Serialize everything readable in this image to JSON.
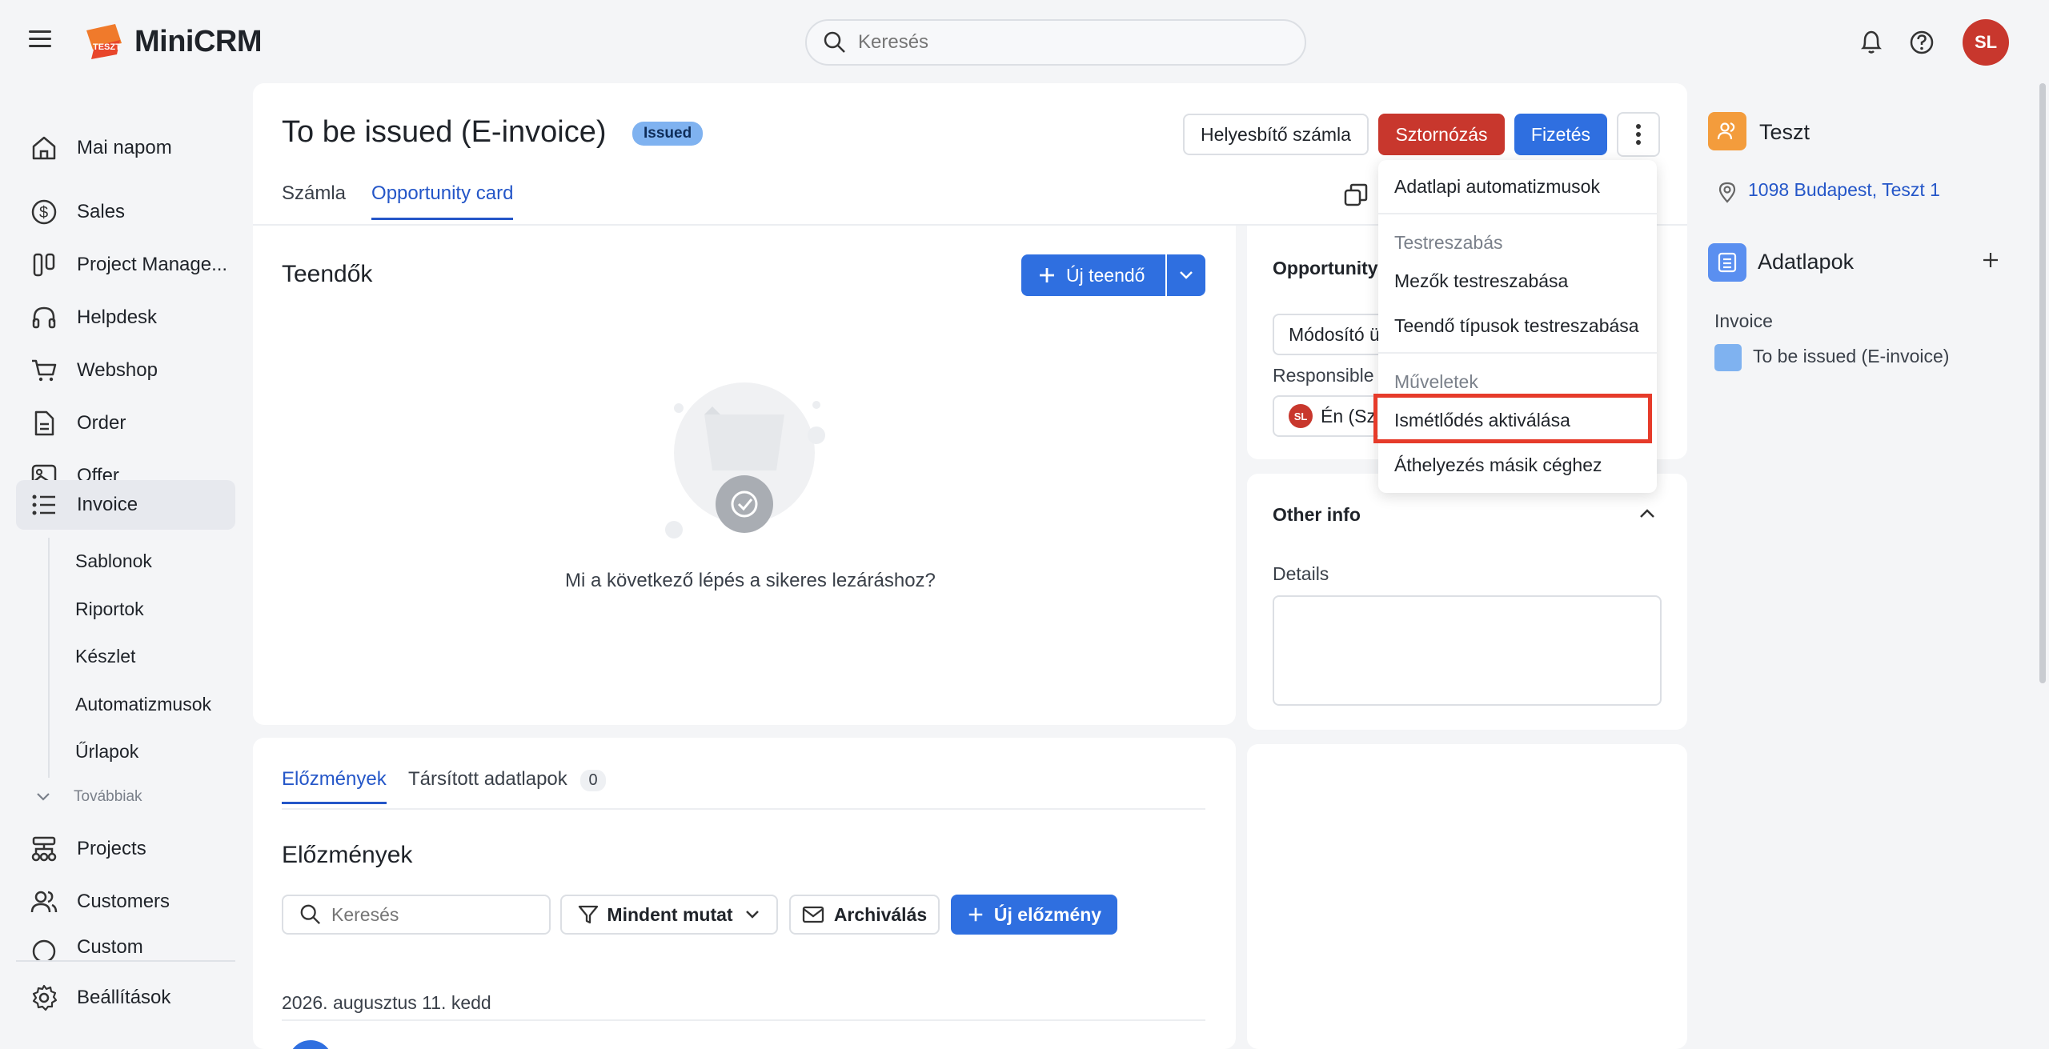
{
  "app": {
    "name": "MiniCRM",
    "logo_tag": "TESZT"
  },
  "topbar": {
    "search_placeholder": "Keresés",
    "avatar_initials": "SL"
  },
  "sidebar": {
    "items": [
      {
        "label": "Mai napom",
        "icon": "home-icon"
      },
      {
        "label": "Sales",
        "icon": "dollar-icon"
      },
      {
        "label": "Project Manage...",
        "icon": "columns-icon"
      },
      {
        "label": "Helpdesk",
        "icon": "headset-icon"
      },
      {
        "label": "Webshop",
        "icon": "cart-icon"
      },
      {
        "label": "Order",
        "icon": "document-icon"
      },
      {
        "label": "Offer",
        "icon": "image-icon"
      },
      {
        "label": "Invoice",
        "icon": "list-icon"
      }
    ],
    "sub_items": [
      "Sablonok",
      "Riportok",
      "Készlet",
      "Automatizmusok",
      "Űrlapok"
    ],
    "more_label": "Továbbiak",
    "bottom_items": [
      {
        "label": "Projects",
        "icon": "sitemap-icon"
      },
      {
        "label": "Customers",
        "icon": "users-icon"
      },
      {
        "label": "Custom",
        "icon": "circle-icon"
      }
    ],
    "settings_label": "Beállítások"
  },
  "header": {
    "title": "To be issued (E-invoice)",
    "badge": "Issued",
    "btn_corrective": "Helyesbítő számla",
    "btn_storno": "Sztornózás",
    "btn_payment": "Fizetés",
    "tabs": [
      "Számla",
      "Opportunity card"
    ]
  },
  "todos": {
    "title": "Teendők",
    "new_btn": "Új teendő",
    "empty_text": "Mi a következő lépés a sikeres lezáráshoz?"
  },
  "history": {
    "tabs": [
      "Előzmények",
      "Társított adatlapok"
    ],
    "linked_count": "0",
    "title": "Előzmények",
    "search_placeholder": "Keresés",
    "filter_label": "Mindent mutat",
    "archive_label": "Archiválás",
    "new_btn": "Új előzmény",
    "date": "2026. augusztus 11. kedd"
  },
  "opportunity": {
    "title": "Opportunity",
    "modifier_label": "Módosító ü",
    "responsible_label": "Responsible",
    "responsible_value": "Én (Sz",
    "responsible_initials": "SL"
  },
  "other_info": {
    "title": "Other info",
    "details_label": "Details"
  },
  "dropdown": {
    "item_auto": "Adatlapi automatizmusok",
    "header_custom": "Testreszabás",
    "item_fields": "Mezők testreszabása",
    "item_todo_types": "Teendő típusok testreszabása",
    "header_ops": "Műveletek",
    "item_repeat": "Ismétlődés aktiválása",
    "item_move": "Áthelyezés másik céghez"
  },
  "right_panel": {
    "company": "Teszt",
    "address": "1098 Budapest, Teszt 1",
    "sheets_title": "Adatlapok",
    "group": "Invoice",
    "sheet_item": "To be issued (E-invoice)"
  },
  "colors": {
    "accent_blue": "#2f6fe0",
    "danger_red": "#c8372d",
    "badge_blue": "#7fb2f0",
    "highlight": "#e63b2a"
  }
}
